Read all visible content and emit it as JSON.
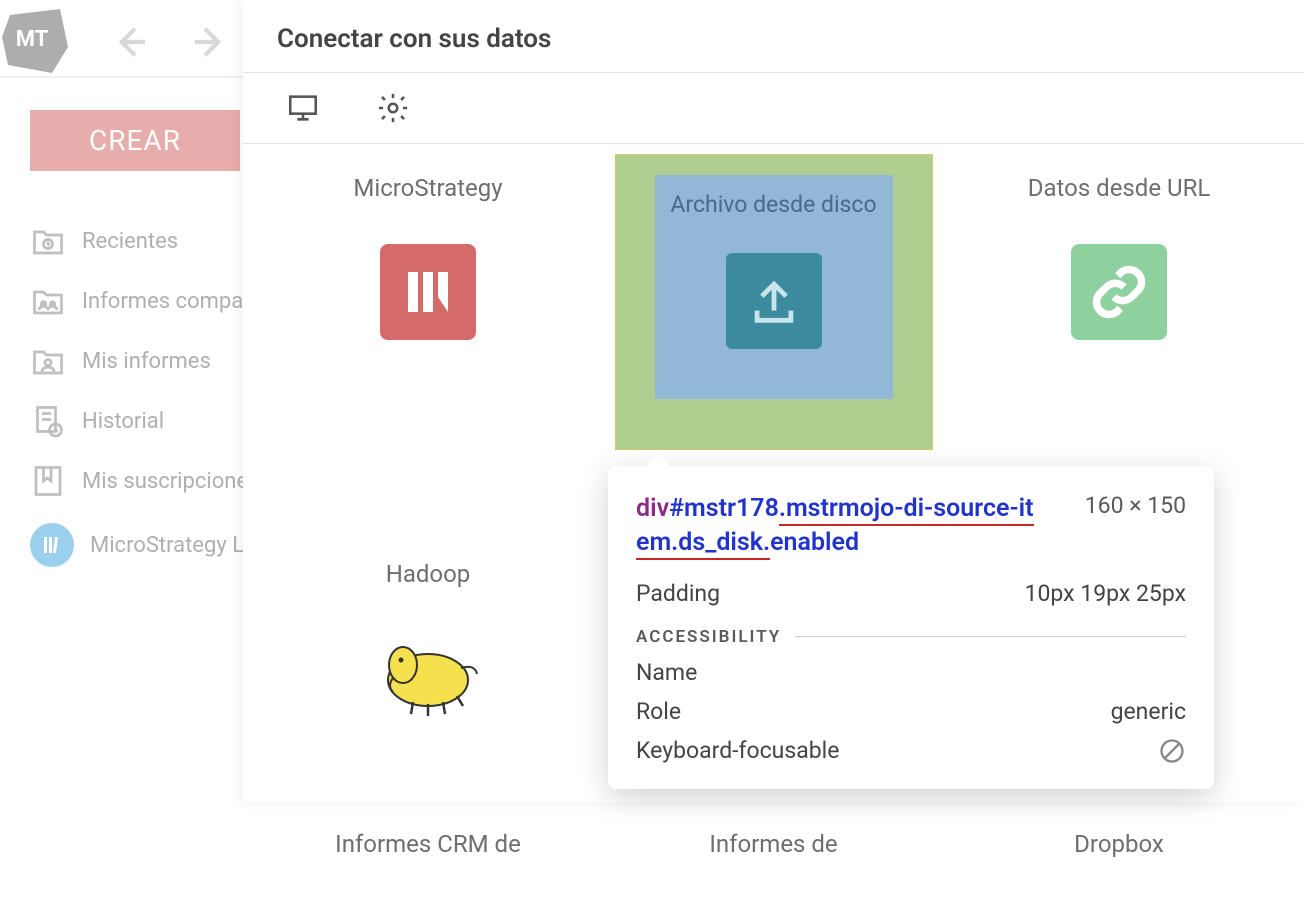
{
  "app": {
    "logo_text": "MT"
  },
  "sidebar": {
    "create_label": "CREAR",
    "items": [
      {
        "label": "Recientes",
        "icon": "recent"
      },
      {
        "label": "Informes compa",
        "icon": "shared"
      },
      {
        "label": "Mis informes",
        "icon": "user-folder"
      },
      {
        "label": "Historial",
        "icon": "history"
      },
      {
        "label": "Mis suscripcione",
        "icon": "bookmark"
      },
      {
        "label": "MicroStrategy Li",
        "icon": "library",
        "variant": "lib"
      }
    ]
  },
  "panel": {
    "title": "Conectar con sus datos",
    "sources": {
      "row1": [
        {
          "label": "MicroStrategy"
        },
        {
          "label": "Archivo desde disco"
        },
        {
          "label": "Datos desde URL"
        }
      ],
      "row2": [
        {
          "label": "Hadoop"
        },
        {
          "label": ""
        },
        {
          "label": ""
        }
      ],
      "row3": [
        {
          "label": "Informes CRM de"
        },
        {
          "label": "Informes de"
        },
        {
          "label": "Dropbox"
        }
      ]
    }
  },
  "tooltip": {
    "tag": "div",
    "id": "#mstr178",
    "cls_underlined_1": ".mstrmojo-di-source-it",
    "cls_underlined_2": "em.ds_disk.",
    "cls_rest": "enabled",
    "dimensions": "160 × 150",
    "padding_label": "Padding",
    "padding_value": "10px 19px 25px",
    "accessibility_header": "ACCESSIBILITY",
    "name_label": "Name",
    "role_label": "Role",
    "role_value": "generic",
    "kbf_label": "Keyboard-focusable"
  }
}
